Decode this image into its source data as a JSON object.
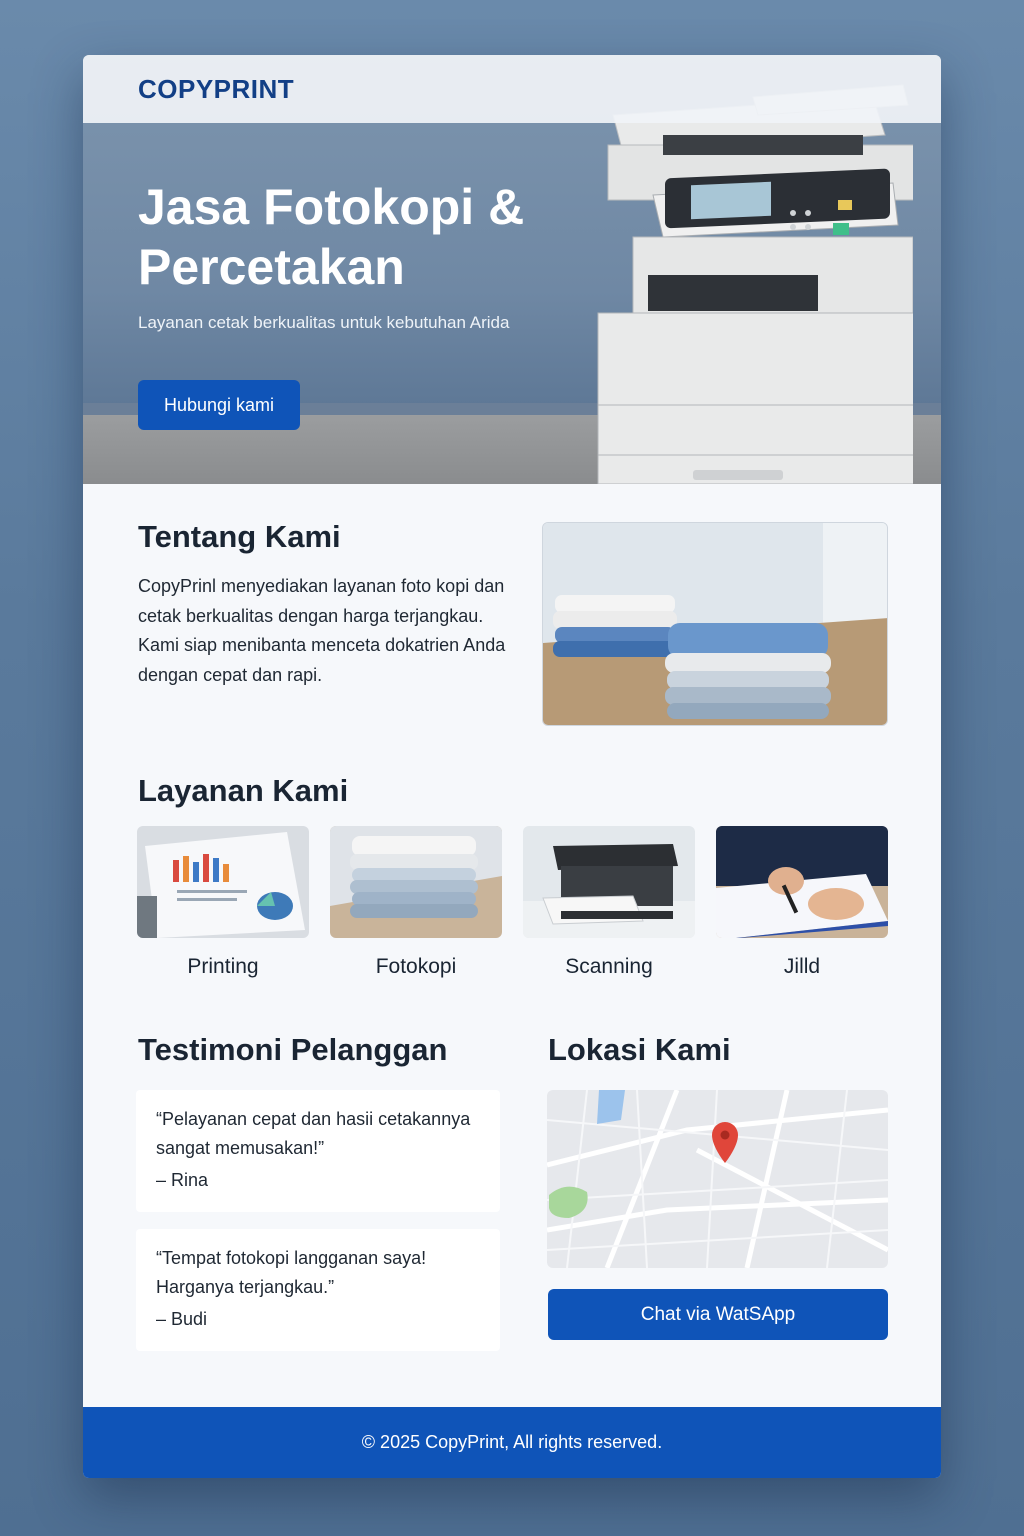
{
  "brand": {
    "logo_text": "COPYPRINT"
  },
  "hero": {
    "title": "Jasa Fotokopi & Percetakan",
    "subtitle": "Layanan cetak berkualitas untuk kebutuhan Arida",
    "cta_label": "Hubungi kami"
  },
  "about": {
    "heading": "Tentang Kami",
    "body": "CopyPrinl menyediakan layanan foto kopi dan cetak berkualitas dengan harga terjangkau. Kami siap menibanta menceta dokatrien Anda dengan cepat dan rapi."
  },
  "services": {
    "heading": "Layanan Kami",
    "items": [
      {
        "label": "Printing",
        "icon": "printed-chart-document-image"
      },
      {
        "label": "Fotokopi",
        "icon": "paper-stack-image"
      },
      {
        "label": "Scanning",
        "icon": "scanner-image"
      },
      {
        "label": "Jilld",
        "icon": "writing-notebook-image"
      }
    ]
  },
  "testimonials": {
    "heading": "Testimoni Pelanggan",
    "items": [
      {
        "quote": "“Pelayanan cepat dan hasii cetakannya sangat memusakan!”",
        "author": "– Rina"
      },
      {
        "quote": "“Tempat fotokopi langganan saya! Harganya terjangkau.”",
        "author": "– Budi"
      }
    ]
  },
  "location": {
    "heading": "Lokasi Kami",
    "map_icon": "map-pin-icon",
    "chat_label": "Chat via WatSApp"
  },
  "footer": {
    "text": "© 2025 CopyPrint,  All rights reserved."
  },
  "colors": {
    "primary": "#0f54b8",
    "brand_text": "#123f86",
    "heading": "#1a2533",
    "pin": "#e0463a"
  }
}
